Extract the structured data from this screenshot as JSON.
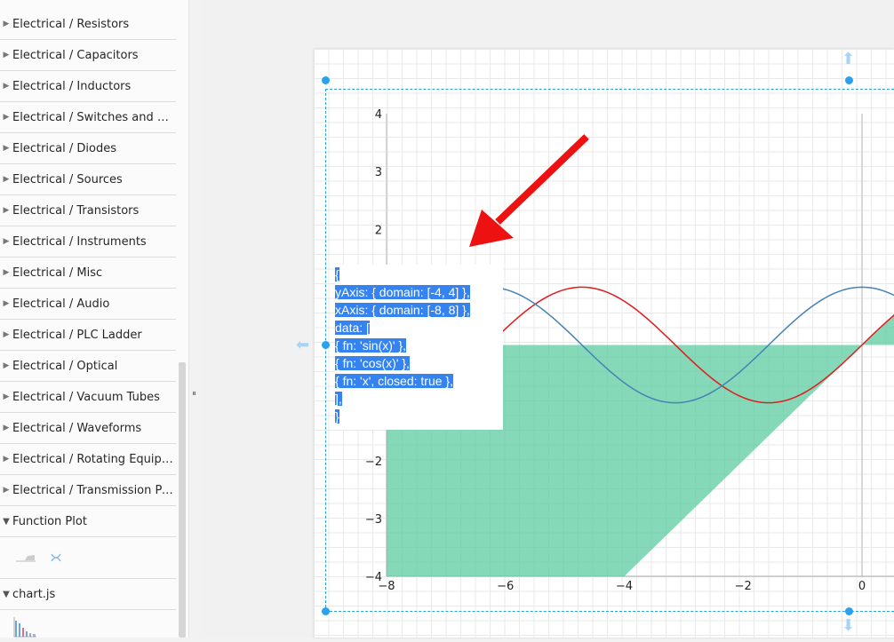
{
  "sidebar": {
    "items": [
      "Electrical / Resistors",
      "Electrical / Capacitors",
      "Electrical / Inductors",
      "Electrical / Switches and Relays",
      "Electrical / Diodes",
      "Electrical / Sources",
      "Electrical / Transistors",
      "Electrical / Instruments",
      "Electrical / Misc",
      "Electrical / Audio",
      "Electrical / PLC Ladder",
      "Electrical / Optical",
      "Electrical / Vacuum Tubes",
      "Electrical / Waveforms",
      "Electrical / Rotating Equipment",
      "Electrical / Transmission Paths"
    ],
    "sections": [
      {
        "label": "Function Plot"
      },
      {
        "label": "chart.js"
      }
    ]
  },
  "editor": {
    "lines": [
      "{",
      "yAxis: { domain: [-4, 4] },",
      "xAxis: { domain: [-8, 8] },",
      "data: [",
      "{ fn: 'sin(x)' },",
      "{ fn: 'cos(x)' },",
      "{ fn: 'x', closed: true },",
      "],",
      "}"
    ]
  },
  "chart_data": {
    "type": "line",
    "xlim": [
      -8,
      8
    ],
    "ylim": [
      -4,
      4
    ],
    "x_ticks": [
      "−8",
      "−6",
      "−4",
      "−2",
      "0"
    ],
    "y_ticks": [
      "4",
      "3",
      "2",
      "−2",
      "−3",
      "−4"
    ],
    "series": [
      {
        "fn": "sin(x)",
        "color": "#e31a1c"
      },
      {
        "fn": "cos(x)",
        "color": "#4682b4"
      },
      {
        "fn": "x",
        "closed": true,
        "color": "#5ccca0"
      }
    ],
    "grid": true
  },
  "colors": {
    "selection": "#29a1d8",
    "highlight": "#3583f0",
    "annotation_arrow": "#ee1111"
  }
}
